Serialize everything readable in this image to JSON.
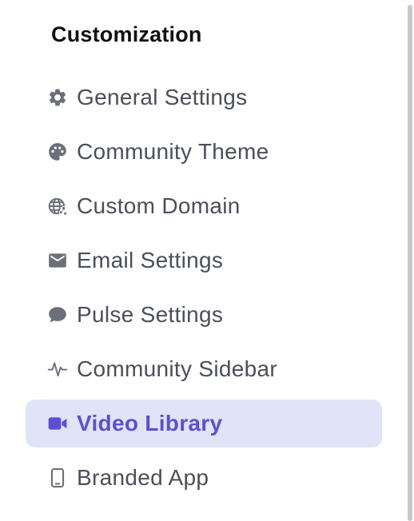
{
  "section": {
    "title": "Customization"
  },
  "menu": {
    "items": [
      {
        "label": "General Settings",
        "icon": "gear-icon",
        "active": false
      },
      {
        "label": "Community Theme",
        "icon": "palette-icon",
        "active": false
      },
      {
        "label": "Custom Domain",
        "icon": "globe-share-icon",
        "active": false
      },
      {
        "label": "Email Settings",
        "icon": "envelope-icon",
        "active": false
      },
      {
        "label": "Pulse Settings",
        "icon": "chat-bubble-icon",
        "active": false
      },
      {
        "label": "Community Sidebar",
        "icon": "pulse-line-icon",
        "active": false
      },
      {
        "label": "Video Library",
        "icon": "video-camera-icon",
        "active": true
      },
      {
        "label": "Branded App",
        "icon": "smartphone-icon",
        "active": false
      }
    ]
  },
  "colors": {
    "text": "#4a4f5a",
    "icon": "#6b6f78",
    "active_text": "#5b4fd6",
    "active_background": "#e1e3f6",
    "title": "#111111"
  }
}
